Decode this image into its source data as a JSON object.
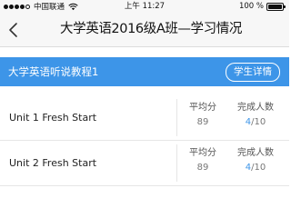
{
  "status_bar": {
    "carrier": "中国联通",
    "time": "上午 11:27",
    "battery_percent": "100 %",
    "battery_level": 1.0,
    "signal_strength": 4,
    "signal_max": 5,
    "icons": [
      "signal-dots-icon",
      "wifi-icon",
      "battery-icon"
    ]
  },
  "nav": {
    "back_icon": "chevron-left-icon",
    "title": "大学英语2016级A班—学习情况"
  },
  "course": {
    "name": "大学英语听说教程1",
    "student_detail_label": "学生详情",
    "accent_color": "#3d95e8"
  },
  "units": [
    {
      "name": "Unit 1 Fresh Start",
      "avg_label": "平均分",
      "avg_value": "89",
      "done_label": "完成人数",
      "done_count": "4",
      "done_total": "/10"
    },
    {
      "name": "Unit 2 Fresh Start",
      "avg_label": "平均分",
      "avg_value": "89",
      "done_label": "完成人数",
      "done_count": "4",
      "done_total": "/10"
    }
  ]
}
